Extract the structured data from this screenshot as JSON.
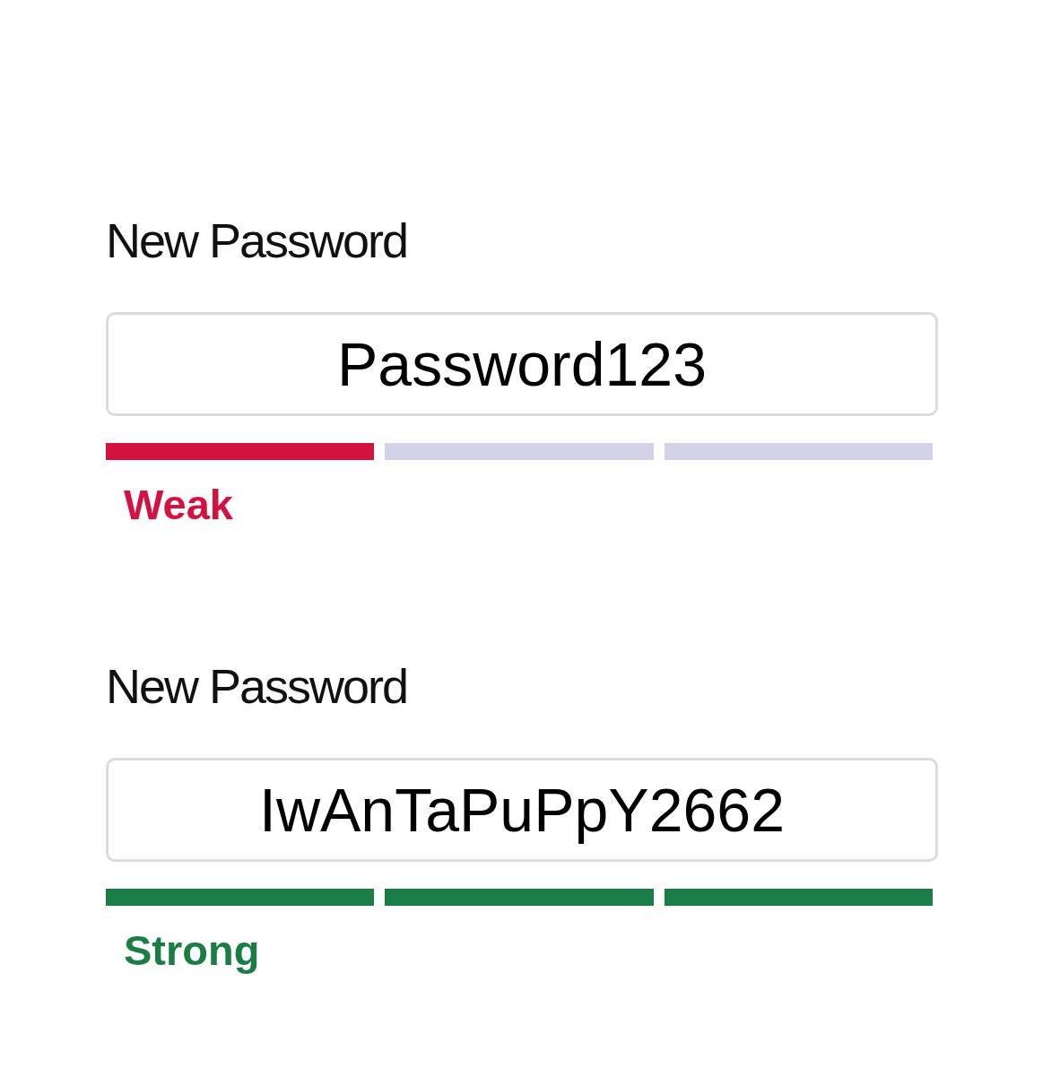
{
  "password_fields": [
    {
      "label": "New Password",
      "value": "Password123",
      "color": "#d4123f",
      "strength": "Weak",
      "segments": [
        {
          "on": true
        },
        {
          "on": false
        },
        {
          "on": false
        }
      ]
    },
    {
      "label": "New Password",
      "value": "IwAnTaPuPpY2662",
      "color": "#1a7d45",
      "strength": "Strong",
      "segments": [
        {
          "on": true
        },
        {
          "on": true
        },
        {
          "on": true
        }
      ]
    }
  ]
}
